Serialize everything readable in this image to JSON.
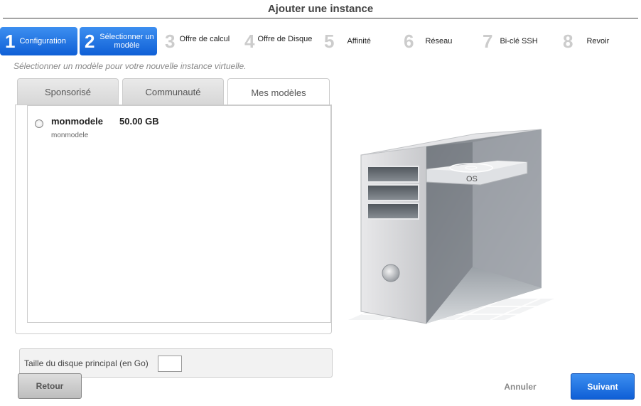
{
  "window": {
    "title": "Ajouter une instance"
  },
  "steps": [
    {
      "num": "1",
      "label": "Configuration",
      "state": "active"
    },
    {
      "num": "2",
      "label": "Sélectionner un modèle",
      "state": "active"
    },
    {
      "num": "3",
      "label": "Offre de calcul",
      "state": "inactive"
    },
    {
      "num": "4",
      "label": "Offre de Disque",
      "state": "inactive"
    },
    {
      "num": "5",
      "label": "Affinité",
      "state": "inactive"
    },
    {
      "num": "6",
      "label": "Réseau",
      "state": "inactive"
    },
    {
      "num": "7",
      "label": "Bi-clé SSH",
      "state": "inactive"
    },
    {
      "num": "8",
      "label": "Revoir",
      "state": "inactive"
    }
  ],
  "description": "Sélectionner un modèle pour votre nouvelle instance virtuelle.",
  "tabs": [
    {
      "label": "Sponsorisé",
      "active": false
    },
    {
      "label": "Communauté",
      "active": false
    },
    {
      "label": "Mes modèles",
      "active": true
    }
  ],
  "templates": [
    {
      "name": "monmodele",
      "size": "50.00 GB",
      "subtitle": "monmodele",
      "selected": false
    }
  ],
  "disk": {
    "label": "Taille du disque principal (en Go)",
    "value": ""
  },
  "illustration": {
    "label": "OS"
  },
  "buttons": {
    "back": "Retour",
    "cancel": "Annuler",
    "next": "Suivant"
  },
  "colors": {
    "accent": "#1f6fe0",
    "inactive_step": "#cccccc"
  }
}
